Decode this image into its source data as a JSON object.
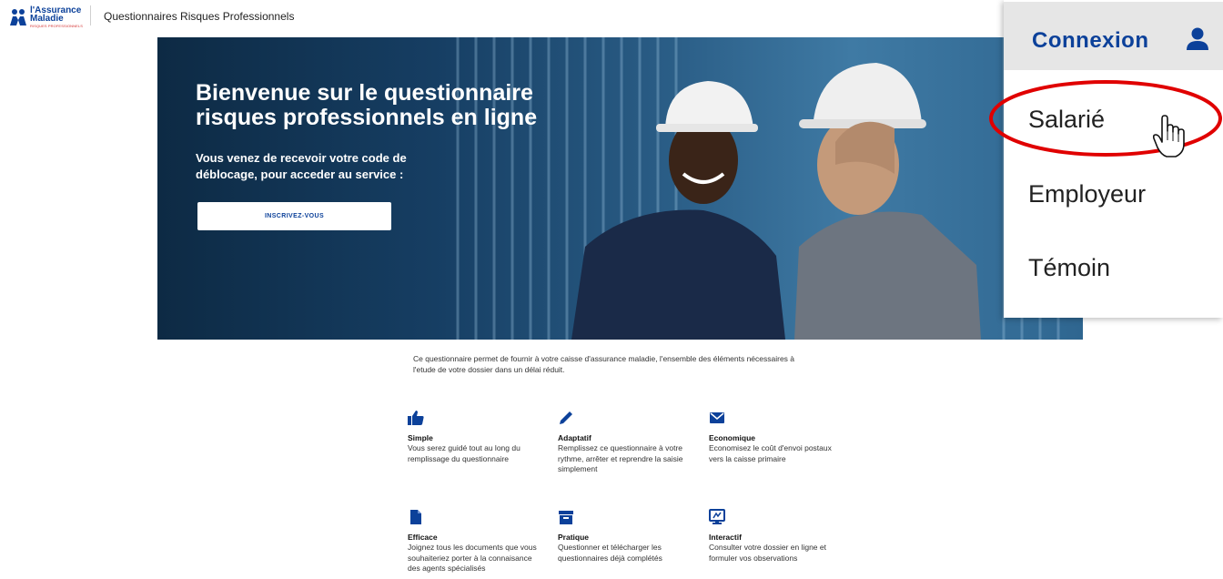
{
  "header": {
    "logo_line1": "l'Assurance",
    "logo_line2": "Maladie",
    "logo_line3": "RISQUES PROFESSIONNELS",
    "app_title": "Questionnaires Risques Professionnels"
  },
  "hero": {
    "title": "Bienvenue sur le questionnaire risques professionnels en ligne",
    "subtitle": "Vous venez de recevoir votre code de déblocage, pour acceder au service :",
    "button_label": "INSCRIVEZ-VOUS"
  },
  "intro": "Ce questionnaire permet de fournir à votre caisse d'assurance maladie, l'ensemble des éléments nécessaires à l'etude de votre dossier dans un délai réduit.",
  "features": [
    {
      "icon": "thumbs-up-icon",
      "title": "Simple",
      "text": "Vous serez guidé tout au long du remplissage du questionnaire"
    },
    {
      "icon": "pencil-icon",
      "title": "Adaptatif",
      "text": "Remplissez ce questionnaire à votre rythme, arrêter et reprendre la saisie simplement"
    },
    {
      "icon": "envelope-icon",
      "title": "Economique",
      "text": "Economisez le coût d'envoi postaux vers la caisse primaire"
    },
    {
      "icon": "document-icon",
      "title": "Efficace",
      "text": "Joignez tous les documents que vous souhaiteriez porter à la connaisance des agents spécialisés"
    },
    {
      "icon": "archive-icon",
      "title": "Pratique",
      "text": "Questionner et télécharger les questionnaires déjà complétés"
    },
    {
      "icon": "monitor-icon",
      "title": "Interactif",
      "text": "Consulter votre dossier en ligne et formuler vos observations"
    }
  ],
  "connexion_menu": {
    "label": "Connexion",
    "icon": "user-icon",
    "items": [
      "Salarié",
      "Employeur",
      "Témoin"
    ],
    "highlighted_item": "Salarié"
  },
  "colors": {
    "brand_blue": "#0c419a",
    "highlight_red": "#e00000",
    "menu_header_bg": "#e6e6e6"
  }
}
